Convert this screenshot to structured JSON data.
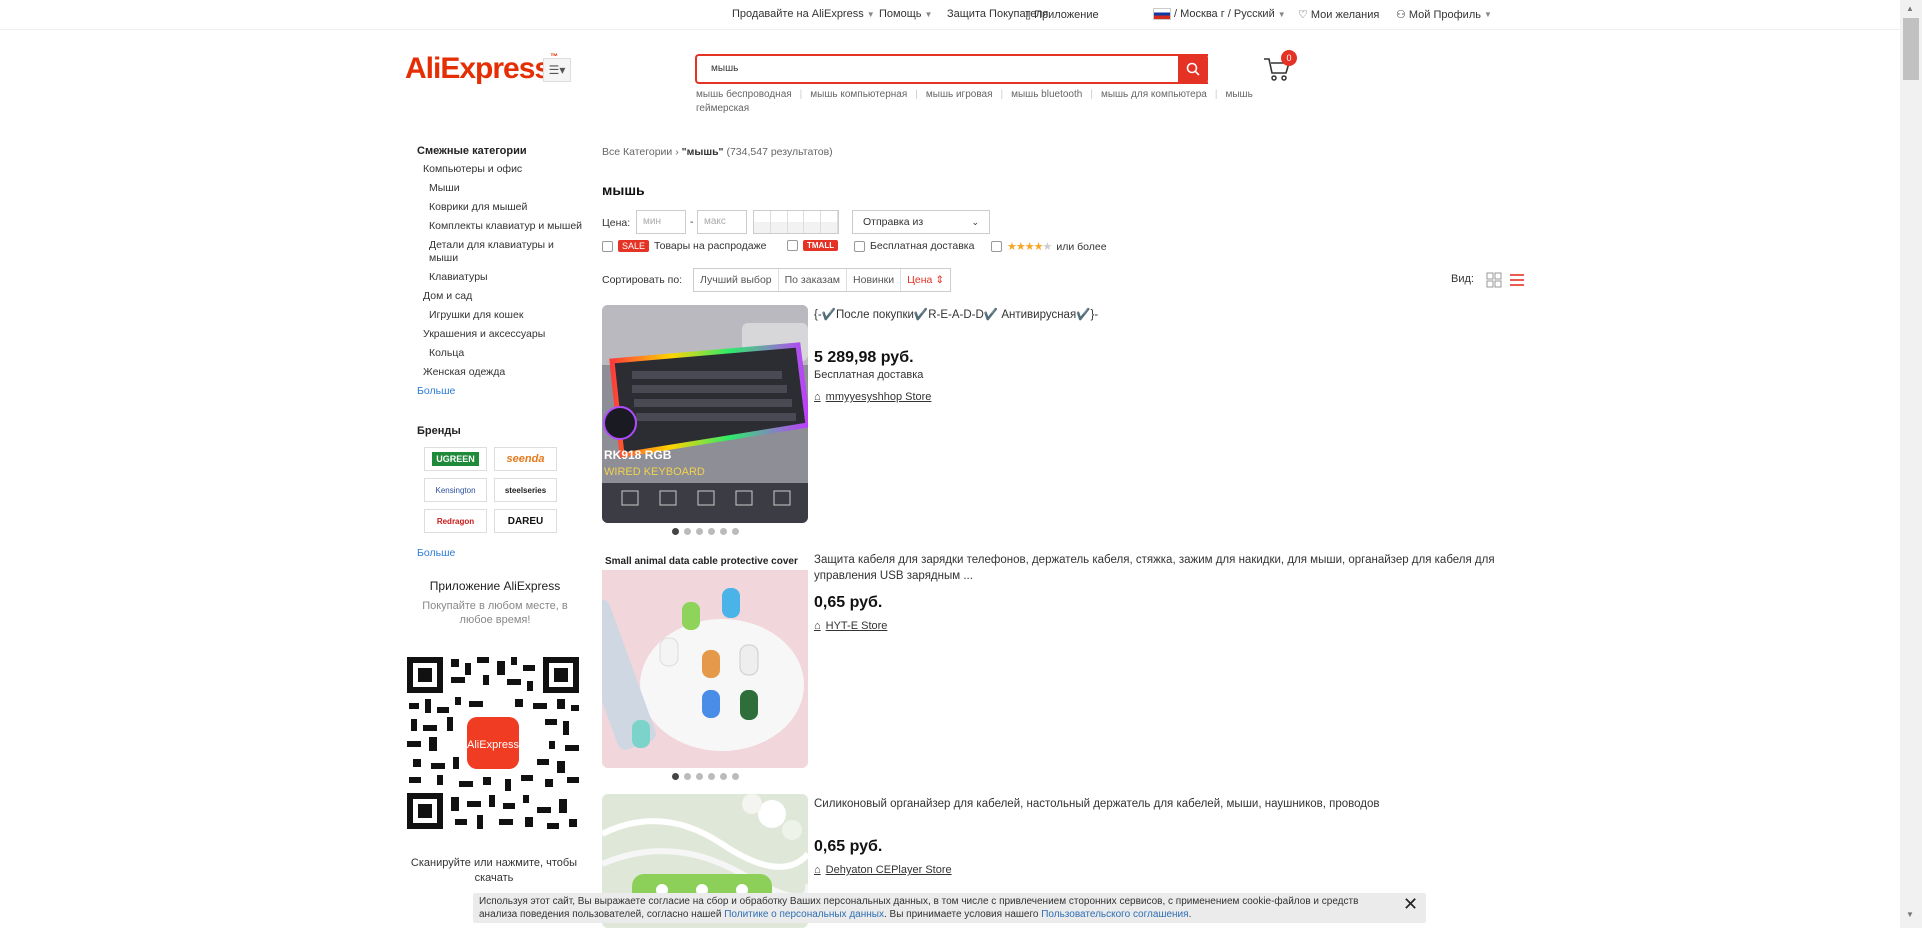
{
  "topbar": {
    "sell": "Продавайте на AliExpress",
    "help": "Помощь",
    "protection": "Защита Покупателя",
    "app": "Приложение",
    "region": "/ Москва г / Русский",
    "wishlist": "Мои желания",
    "profile": "Мой Профиль"
  },
  "header": {
    "logo": "AliExpress",
    "search_value": "мышь",
    "cart_count": "0",
    "suggestions": [
      "мышь беспроводная",
      "мышь компьютерная",
      "мышь игровая",
      "мышь bluetooth",
      "мышь для компьютера",
      "мышь геймерская"
    ]
  },
  "sidebar": {
    "related_title": "Смежные категории",
    "categories": [
      {
        "label": "Компьютеры и офис",
        "level": 1
      },
      {
        "label": "Мыши",
        "level": 2
      },
      {
        "label": "Коврики для мышей",
        "level": 2
      },
      {
        "label": "Комплекты клавиатур и мышей",
        "level": 2
      },
      {
        "label": "Детали для клавиатуры и мыши",
        "level": 2
      },
      {
        "label": "Клавиатуры",
        "level": 2
      },
      {
        "label": "Дом и сад",
        "level": 1
      },
      {
        "label": "Игрушки для кошек",
        "level": 2
      },
      {
        "label": "Украшения и аксессуары",
        "level": 1
      },
      {
        "label": "Кольца",
        "level": 2
      },
      {
        "label": "Женская одежда",
        "level": 1
      }
    ],
    "more_categories": "Больше",
    "brands_title": "Бренды",
    "brands": [
      "UGREEN",
      "seenda",
      "Kensington",
      "steelseries",
      "Redragon",
      "DAREU"
    ],
    "more_brands": "Больше",
    "app_title": "Приложение AliExpress",
    "app_sub": "Покупайте в любом месте, в любое время!",
    "qr_label": "AliExpress",
    "scan_text": "Сканируйте или нажмите, чтобы скачать"
  },
  "main": {
    "crumb_all": "Все Категории",
    "crumb_query": "\"мышь\"",
    "crumb_count": "(734,547 результатов)",
    "title": "мышь",
    "price_label": "Цена:",
    "min_placeholder": "мин",
    "max_placeholder": "макс",
    "ship_from": "Отправка из",
    "sale_badge": "SALE",
    "sale_text": "Товары на распродаже",
    "tmall_badge": "TMALL",
    "free_ship": "Бесплатная доставка",
    "rating_text": "или более",
    "sort_label": "Сортировать по:",
    "sort_options": [
      "Лучший выбор",
      "По заказам",
      "Новинки",
      "Цена"
    ],
    "view_label": "Вид:"
  },
  "products": [
    {
      "title": "{-✔️После покупки✔️R-E-A-D-D✔️ Антивирусная✔️}-",
      "price": "5 289,98 руб.",
      "shipping": "Бесплатная доставка",
      "store": "mmyyesyshhop Store",
      "image_text_1": "RK918 RGB",
      "image_text_2": "WIRED KEYBOARD"
    },
    {
      "title": "Защита кабеля для зарядки телефонов, держатель кабеля, стяжка, зажим для накидки, для мыши, органайзер для кабеля для управления USB зарядным ...",
      "price": "0,65 руб.",
      "shipping": "",
      "store": "HYT-E Store",
      "image_text_1": "Small animal data cable protective cover"
    },
    {
      "title": "Силиконовый органайзер для кабелей, настольный держатель для кабелей, мыши, наушников, проводов",
      "price": "0,65 руб.",
      "shipping": "",
      "store": "Dehyaton CEPlayer Store"
    }
  ],
  "cookie": {
    "text_1": "Используя этот сайт, Вы выражаете согласие на сбор и обработку Ваших персональных данных, в том числе с привлечением сторонних сервисов, с применением cookie-файлов и средств анализа поведения пользователей, согласно нашей ",
    "link_1": "Политике о персональных данных",
    "text_2": ". Вы принимаете условия нашего ",
    "link_2": "Пользовательского соглашения",
    "text_3": "."
  },
  "colors": {
    "accent": "#e43225",
    "link": "#2e7cd6"
  }
}
